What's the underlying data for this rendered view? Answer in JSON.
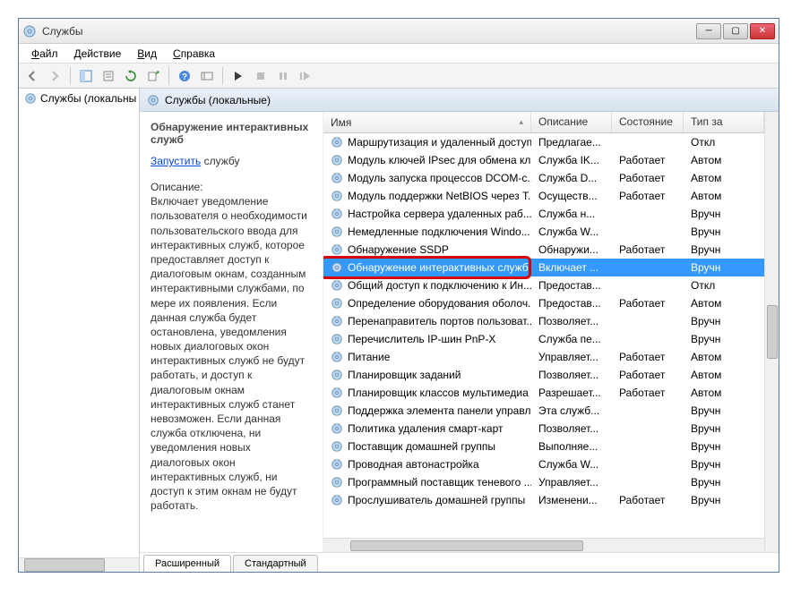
{
  "window": {
    "title": "Службы"
  },
  "menu": {
    "file": "Файл",
    "action": "Действие",
    "view": "Вид",
    "help": "Справка"
  },
  "tree": {
    "root": "Службы (локальны"
  },
  "mainheader": {
    "title": "Службы (локальные)"
  },
  "details": {
    "title": "Обнаружение интерактивных служб",
    "start_link": "Запустить",
    "start_suffix": " службу",
    "desc_label": "Описание:",
    "desc": "Включает уведомление пользователя о необходимости пользовательского ввода для интерактивных служб, которое предоставляет доступ к диалоговым окнам, созданным интерактивными службами, по мере их появления. Если данная служба будет остановлена, уведомления новых диалоговых окон интерактивных служб не будут работать, и доступ к диалоговым окнам интерактивных служб станет невозможен. Если данная служба отключена, ни уведомления новых диалоговых окон интерактивных служб, ни доступ к этим окнам не будут работать."
  },
  "columns": {
    "name": "Имя",
    "desc": "Описание",
    "state": "Состояние",
    "type": "Тип за"
  },
  "services": [
    {
      "name": "Маршрутизация и удаленный доступ",
      "desc": "Предлагае...",
      "state": "",
      "type": "Откл"
    },
    {
      "name": "Модуль ключей IPsec для обмена кл...",
      "desc": "Служба IK...",
      "state": "Работает",
      "type": "Автом"
    },
    {
      "name": "Модуль запуска процессов DCOM-с...",
      "desc": "Служба D...",
      "state": "Работает",
      "type": "Автом"
    },
    {
      "name": "Модуль поддержки NetBIOS через T...",
      "desc": "Осуществ...",
      "state": "Работает",
      "type": "Автом"
    },
    {
      "name": "Настройка сервера удаленных раб...",
      "desc": "Служба н...",
      "state": "",
      "type": "Вручн"
    },
    {
      "name": "Немедленные подключения Windo...",
      "desc": "Служба W...",
      "state": "",
      "type": "Вручн"
    },
    {
      "name": "Обнаружение SSDP",
      "desc": "Обнаружи...",
      "state": "Работает",
      "type": "Вручн"
    },
    {
      "name": "Обнаружение интерактивных служб",
      "desc": "Включает ...",
      "state": "",
      "type": "Вручн"
    },
    {
      "name": "Общий доступ к подключению к Ин...",
      "desc": "Предостав...",
      "state": "",
      "type": "Откл"
    },
    {
      "name": "Определение оборудования оболоч...",
      "desc": "Предостав...",
      "state": "Работает",
      "type": "Автом"
    },
    {
      "name": "Перенаправитель портов пользоват...",
      "desc": "Позволяет...",
      "state": "",
      "type": "Вручн"
    },
    {
      "name": "Перечислитель IP-шин PnP-X",
      "desc": "Служба пе...",
      "state": "",
      "type": "Вручн"
    },
    {
      "name": "Питание",
      "desc": "Управляет...",
      "state": "Работает",
      "type": "Автом"
    },
    {
      "name": "Планировщик заданий",
      "desc": "Позволяет...",
      "state": "Работает",
      "type": "Автом"
    },
    {
      "name": "Планировщик классов мультимедиа",
      "desc": "Разрешает...",
      "state": "Работает",
      "type": "Автом"
    },
    {
      "name": "Поддержка элемента панели управл...",
      "desc": "Эта служб...",
      "state": "",
      "type": "Вручн"
    },
    {
      "name": "Политика удаления смарт-карт",
      "desc": "Позволяет...",
      "state": "",
      "type": "Вручн"
    },
    {
      "name": "Поставщик домашней группы",
      "desc": "Выполняе...",
      "state": "",
      "type": "Вручн"
    },
    {
      "name": "Проводная автонастройка",
      "desc": "Служба W...",
      "state": "",
      "type": "Вручн"
    },
    {
      "name": "Программный поставщик теневого ...",
      "desc": "Управляет...",
      "state": "",
      "type": "Вручн"
    },
    {
      "name": "Прослушиватель домашней группы",
      "desc": "Изменени...",
      "state": "Работает",
      "type": "Вручн"
    }
  ],
  "tabs": {
    "extended": "Расширенный",
    "standard": "Стандартный"
  },
  "selected_index": 7
}
